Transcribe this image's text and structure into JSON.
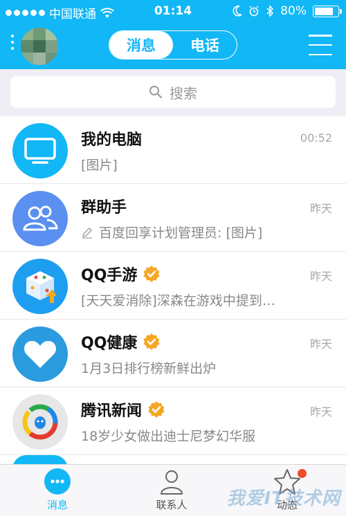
{
  "status_bar": {
    "carrier": "中国联通",
    "time": "01:14",
    "battery": "80%",
    "battery_level": 0.8
  },
  "header": {
    "tabs": [
      {
        "label": "消息",
        "active": true
      },
      {
        "label": "电话",
        "active": false
      }
    ]
  },
  "search": {
    "placeholder": "搜索"
  },
  "conversations": [
    {
      "name": "我的电脑",
      "time": "00:52",
      "preview": "[图片]",
      "icon": "monitor-icon",
      "color": "#12b7f5",
      "verified": false
    },
    {
      "name": "群助手",
      "time": "昨天",
      "preview": "百度回享计划管理员: [图片]",
      "icon": "group-icon",
      "color": "#5b8ff0",
      "verified": false,
      "preview_icon": "pencil-icon"
    },
    {
      "name": "QQ手游",
      "time": "昨天",
      "preview": "[天天爱消除]深森在游戏中提到…",
      "icon": "game-cube-icon",
      "color": "#1e9ef0",
      "verified": true
    },
    {
      "name": "QQ健康",
      "time": "昨天",
      "preview": "1月3日排行榜新鲜出炉",
      "icon": "heart-icon",
      "color": "#2b9bdf",
      "verified": true
    },
    {
      "name": "腾讯新闻",
      "time": "昨天",
      "preview": "18岁少女做出迪士尼梦幻华服",
      "icon": "tencent-news-icon",
      "color": "#e7e7e7",
      "verified": true
    }
  ],
  "tabbar": {
    "items": [
      {
        "label": "消息",
        "icon": "chat-bubble-icon",
        "active": true
      },
      {
        "label": "联系人",
        "icon": "contacts-icon",
        "active": false
      },
      {
        "label": "动态",
        "icon": "star-icon",
        "active": false,
        "badge": true
      }
    ]
  },
  "watermark": "我爱IT技术网",
  "colors": {
    "accent": "#12b7f5",
    "badge": "#f04b2f",
    "verified": "#f5a623"
  }
}
